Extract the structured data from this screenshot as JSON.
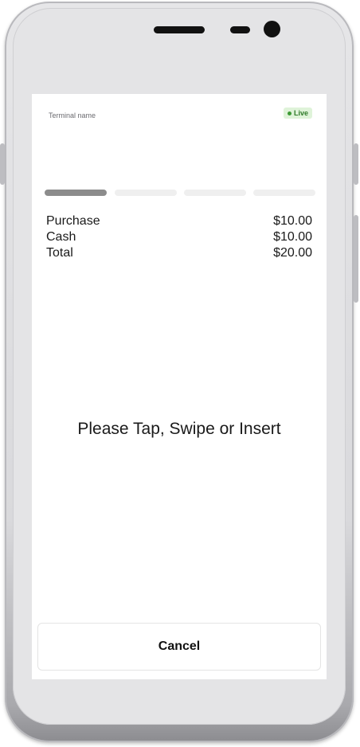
{
  "screen": {
    "terminal_name": "Terminal name",
    "status_badge": "Live",
    "progress": {
      "total_steps": 4,
      "current_step": 1
    },
    "summary": [
      {
        "label": "Purchase",
        "amount": "$10.00"
      },
      {
        "label": "Cash",
        "amount": "$10.00"
      },
      {
        "label": "Total",
        "amount": "$20.00"
      }
    ],
    "prompt": "Please Tap, Swipe or Insert",
    "cancel_label": "Cancel"
  },
  "colors": {
    "live_badge_bg": "#dff3d9",
    "live_dot": "#3d9a35",
    "progress_active": "#8c8c8c",
    "progress_inactive": "#efefef"
  },
  "icons": {
    "live_indicator": "status-dot-icon"
  }
}
